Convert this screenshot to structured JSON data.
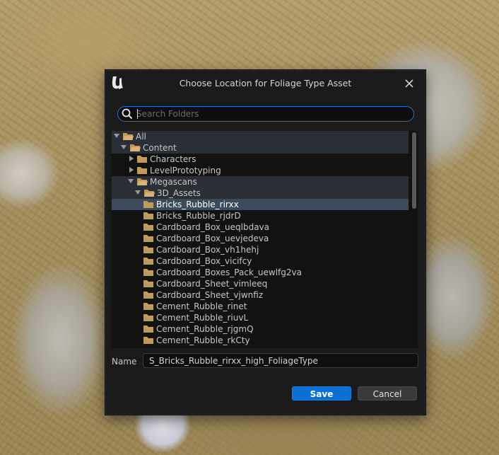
{
  "dialog": {
    "title": "Choose Location for Foliage Type Asset",
    "close_icon": "close-icon",
    "logo_icon": "unreal-logo-icon"
  },
  "search": {
    "placeholder": "Search Folders",
    "value": "",
    "icon": "search-icon"
  },
  "tree": {
    "items": [
      {
        "label": "All",
        "depth": 0,
        "state": "expanded",
        "highlight": true,
        "selected": false
      },
      {
        "label": "Content",
        "depth": 1,
        "state": "expanded",
        "highlight": true,
        "selected": false
      },
      {
        "label": "Characters",
        "depth": 2,
        "state": "collapsed",
        "highlight": false,
        "selected": false
      },
      {
        "label": "LevelPrototyping",
        "depth": 2,
        "state": "collapsed",
        "highlight": false,
        "selected": false
      },
      {
        "label": "Megascans",
        "depth": 2,
        "state": "expanded",
        "highlight": true,
        "selected": false
      },
      {
        "label": "3D_Assets",
        "depth": 3,
        "state": "expanded",
        "highlight": true,
        "selected": false
      },
      {
        "label": "Bricks_Rubble_rirxx",
        "depth": 4,
        "state": "leaf",
        "highlight": false,
        "selected": true
      },
      {
        "label": "Bricks_Rubble_rjdrD",
        "depth": 4,
        "state": "leaf",
        "highlight": false,
        "selected": false
      },
      {
        "label": "Cardboard_Box_ueqlbdava",
        "depth": 4,
        "state": "leaf",
        "highlight": false,
        "selected": false
      },
      {
        "label": "Cardboard_Box_uevjedeva",
        "depth": 4,
        "state": "leaf",
        "highlight": false,
        "selected": false
      },
      {
        "label": "Cardboard_Box_vh1hehj",
        "depth": 4,
        "state": "leaf",
        "highlight": false,
        "selected": false
      },
      {
        "label": "Cardboard_Box_vicifcy",
        "depth": 4,
        "state": "leaf",
        "highlight": false,
        "selected": false
      },
      {
        "label": "Cardboard_Boxes_Pack_uewlfg2va",
        "depth": 4,
        "state": "leaf",
        "highlight": false,
        "selected": false
      },
      {
        "label": "Cardboard_Sheet_vimleeq",
        "depth": 4,
        "state": "leaf",
        "highlight": false,
        "selected": false
      },
      {
        "label": "Cardboard_Sheet_vjwnfiz",
        "depth": 4,
        "state": "leaf",
        "highlight": false,
        "selected": false
      },
      {
        "label": "Cement_Rubble_rinet",
        "depth": 4,
        "state": "leaf",
        "highlight": false,
        "selected": false
      },
      {
        "label": "Cement_Rubble_riuvL",
        "depth": 4,
        "state": "leaf",
        "highlight": false,
        "selected": false
      },
      {
        "label": "Cement_Rubble_rjgmQ",
        "depth": 4,
        "state": "leaf",
        "highlight": false,
        "selected": false
      },
      {
        "label": "Cement_Rubble_rkCty",
        "depth": 4,
        "state": "leaf",
        "highlight": false,
        "selected": false
      },
      {
        "label": "",
        "depth": 4,
        "state": "leaf",
        "highlight": false,
        "selected": false
      }
    ]
  },
  "name_field": {
    "label": "Name",
    "value": "S_Bricks_Rubble_rirxx_high_FoliageType"
  },
  "buttons": {
    "save_label": "Save",
    "cancel_label": "Cancel"
  },
  "colors": {
    "accent": "#0a70d6",
    "folder": "#c29a5b",
    "selected_row": "#3d4a5c",
    "highlight_row": "#2a2f36",
    "dialog_bg": "#1a1a1a"
  }
}
